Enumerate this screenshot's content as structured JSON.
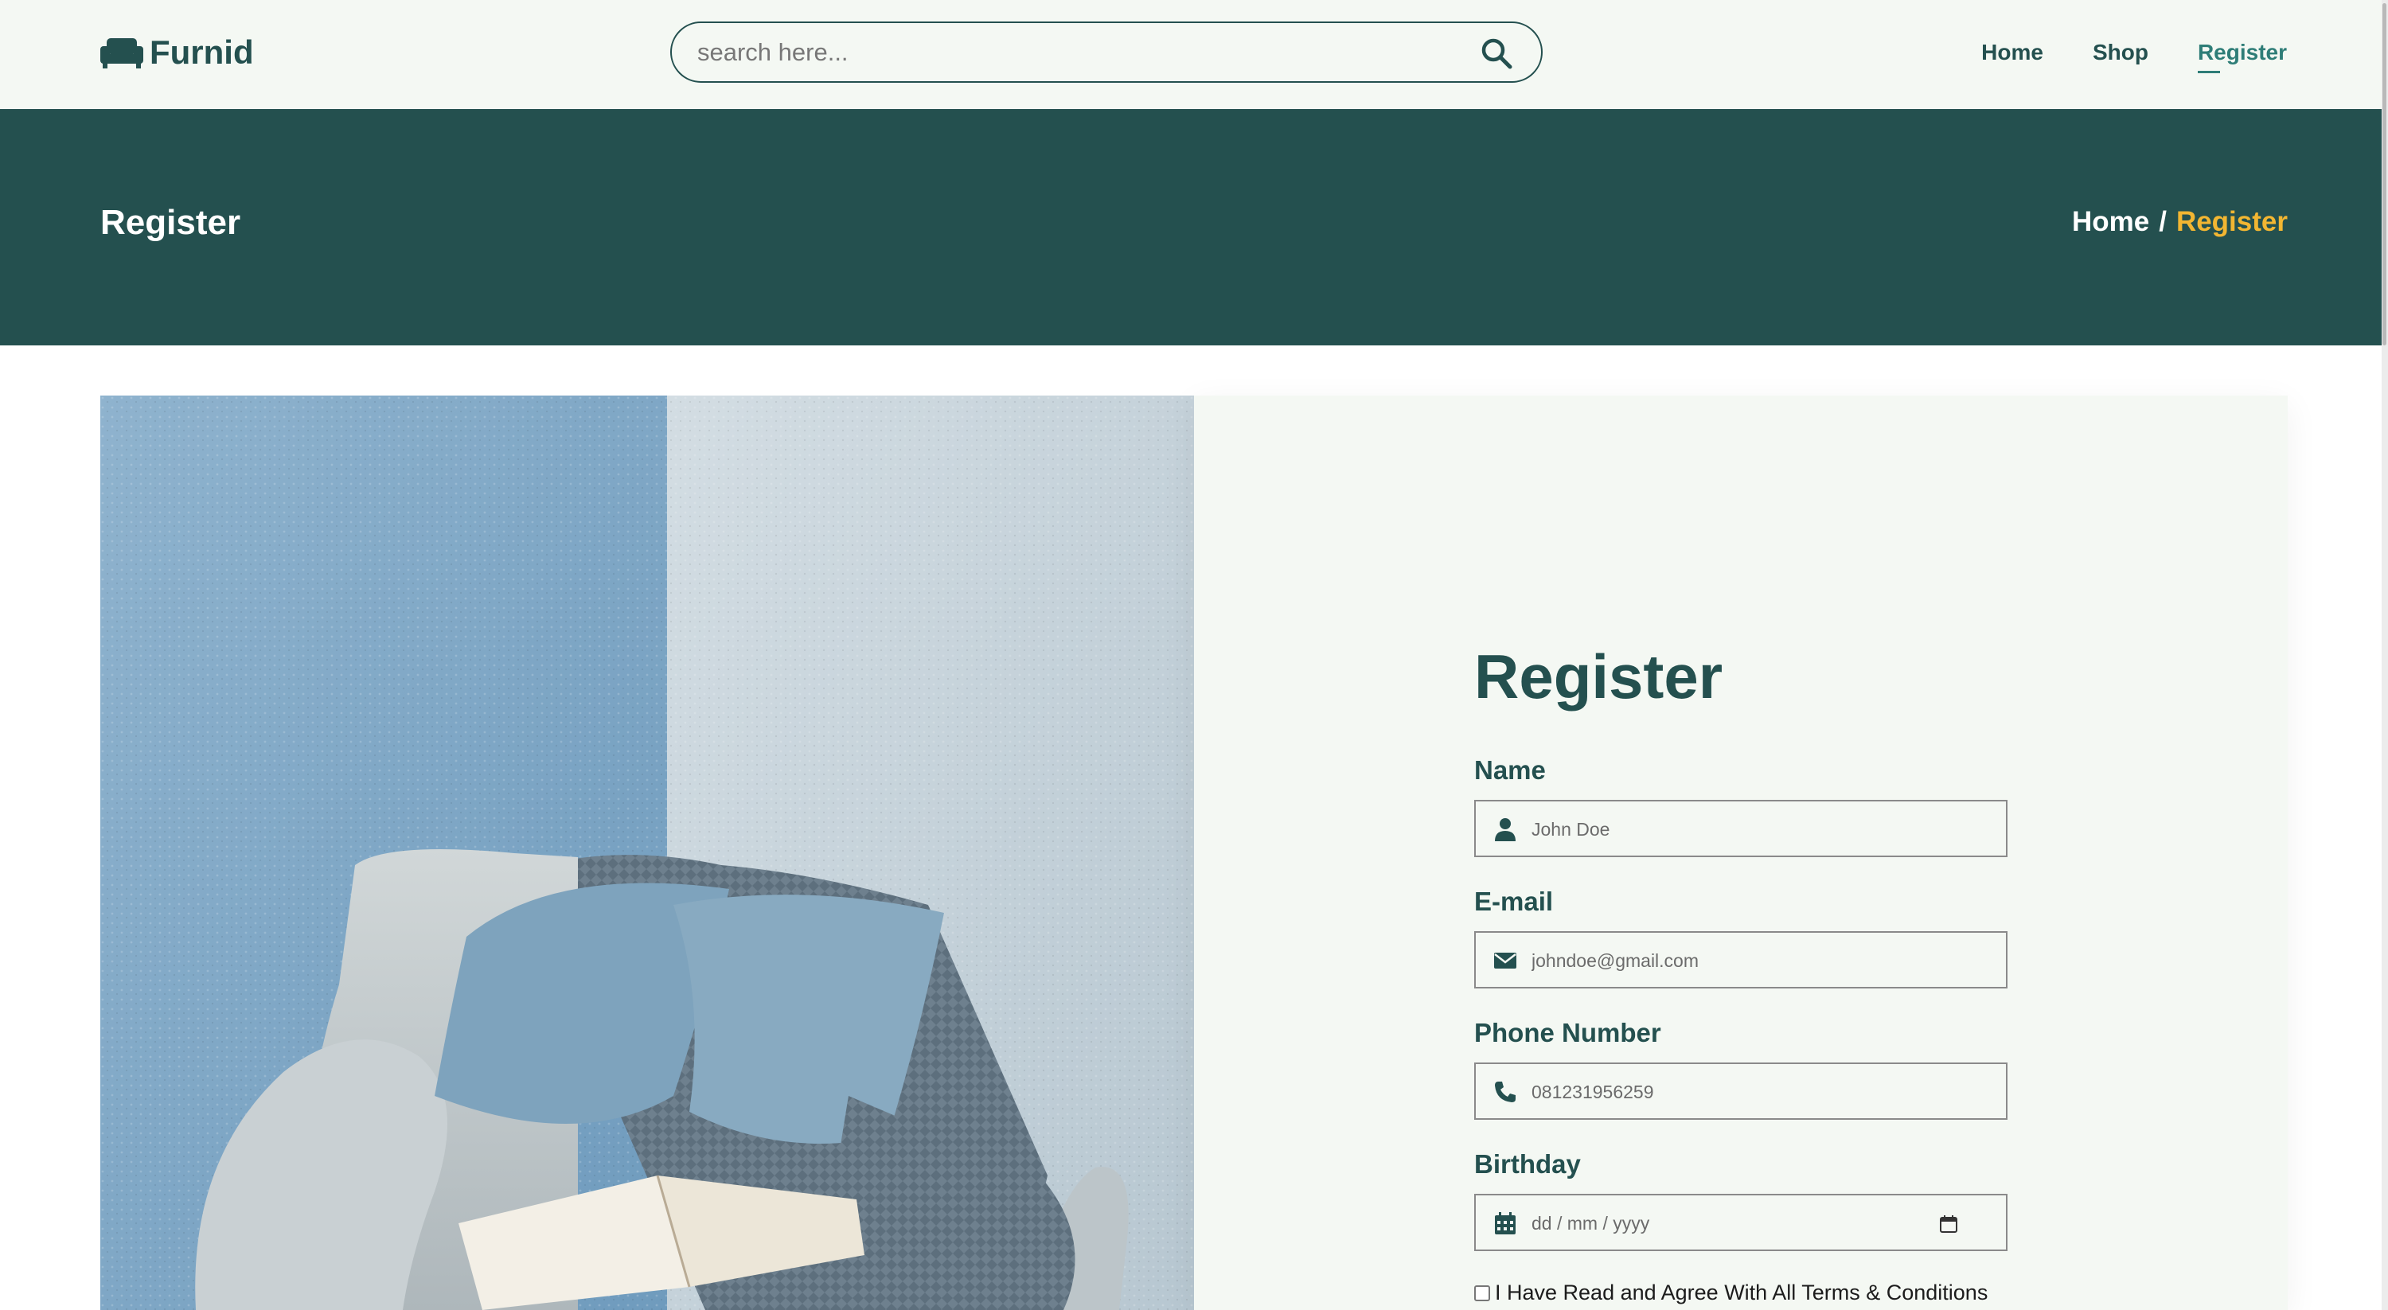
{
  "brand": {
    "name": "Furnid",
    "icon": "sofa-icon",
    "color": "#24504f"
  },
  "search": {
    "placeholder": "search here...",
    "icon": "search-icon"
  },
  "nav": {
    "items": [
      {
        "label": "Home",
        "active": false
      },
      {
        "label": "Shop",
        "active": false
      },
      {
        "label": "Register",
        "active": true
      }
    ]
  },
  "banner": {
    "title": "Register",
    "breadcrumb": {
      "home": "Home",
      "separator": "/",
      "current": "Register"
    },
    "background": "#24504f",
    "accent": "#f2b632"
  },
  "hero_image": {
    "description_icon": "armchair-photo"
  },
  "form": {
    "title": "Register",
    "fields": [
      {
        "label": "Name",
        "placeholder": "John Doe",
        "icon": "user-icon"
      },
      {
        "label": "E-mail",
        "placeholder": "johndoe@gmail.com",
        "icon": "envelope-icon"
      },
      {
        "label": "Phone Number",
        "placeholder": "081231956259",
        "icon": "phone-icon"
      },
      {
        "label": "Birthday",
        "placeholder": "dd / mm / yyyy",
        "icon": "calendar-icon"
      }
    ],
    "terms_label": "I Have Read and Agree With All Terms & Conditions"
  }
}
